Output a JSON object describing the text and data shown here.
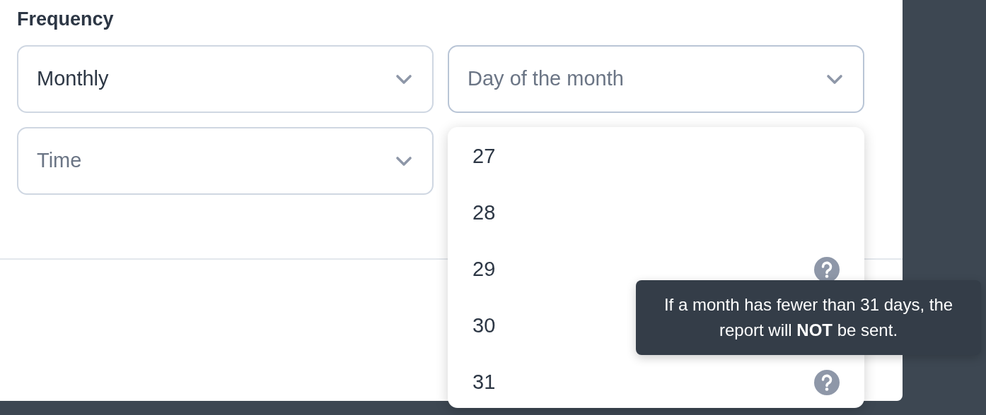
{
  "section_label": "Frequency",
  "selects": [
    {
      "value": "Monthly",
      "open": false
    },
    {
      "placeholder": "Day of the month",
      "open": true
    },
    {
      "placeholder": "Time",
      "open": false
    }
  ],
  "dropdown_options": [
    {
      "label": "27",
      "help_icon": false
    },
    {
      "label": "28",
      "help_icon": false
    },
    {
      "label": "29",
      "help_icon": true
    },
    {
      "label": "30",
      "help_icon": false
    },
    {
      "label": "31",
      "help_icon": true
    }
  ],
  "tooltip": {
    "text": "If a month has fewer than 31 days, the report will **NOT** be sent."
  }
}
